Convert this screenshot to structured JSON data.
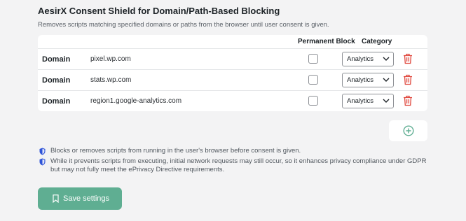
{
  "section": {
    "title": "AesirX Consent Shield for Domain/Path-Based Blocking",
    "subtitle": "Removes scripts matching specified domains or paths from the browser until user consent is given."
  },
  "table": {
    "columns": {
      "permanent_block": "Permanent Block",
      "category": "Category"
    },
    "rows": [
      {
        "kind": "Domain",
        "value": "pixel.wp.com",
        "permanent_block": false,
        "category": "Analytics"
      },
      {
        "kind": "Domain",
        "value": "stats.wp.com",
        "permanent_block": false,
        "category": "Analytics"
      },
      {
        "kind": "Domain",
        "value": "region1.google-analytics.com",
        "permanent_block": false,
        "category": "Analytics"
      }
    ]
  },
  "icons": {
    "delete": "trash-icon",
    "add": "plus-circle-icon",
    "note": "shield-icon",
    "save": "bookmark-icon"
  },
  "notes": [
    "Blocks or removes scripts from running in the user's browser before consent is given.",
    "While it prevents scripts from executing, initial network requests may still occur, so it enhances privacy compliance under GDPR but may not fully meet the ePrivacy Directive requirements."
  ],
  "actions": {
    "save_label": "Save settings"
  },
  "colors": {
    "accent": "#5fae92",
    "delete": "#e0473d",
    "note_icon": "#2f54d8"
  }
}
